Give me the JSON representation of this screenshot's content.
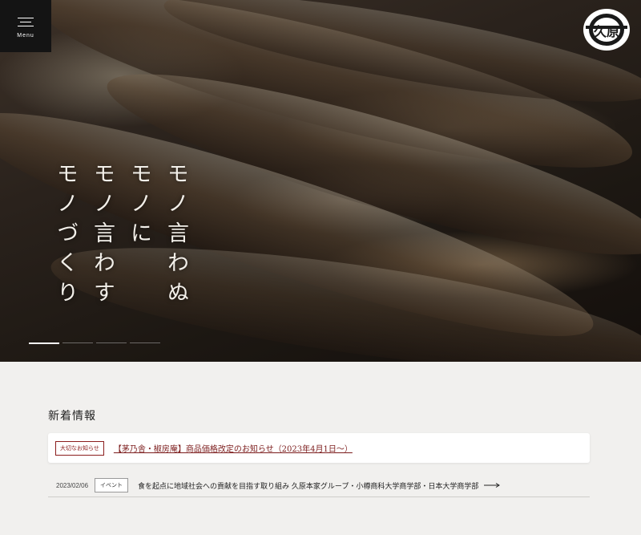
{
  "header": {
    "menu_label": "Menu",
    "logo_text": "久原"
  },
  "hero": {
    "tagline_columns": [
      "モノ言わぬ",
      "モノに",
      "モノ言わす",
      "モノづくり"
    ],
    "slides_total": 4,
    "active_slide": 1
  },
  "news": {
    "heading": "新着情報",
    "featured": {
      "badge": "大切なお知らせ",
      "title": "【茅乃舎・椒房庵】商品価格改定のお知らせ（2023年4月1日〜）"
    },
    "items": [
      {
        "date": "2023/02/06",
        "category": "イベント",
        "title": "食を起点に地域社会への貢献を目指す取り組み 久原本家グループ・小樽商科大学商学部・日本大学商学部 共…"
      }
    ]
  },
  "colors": {
    "accent": "#8b1d1d",
    "menu_bg": "#141414",
    "page_bg": "#f1f0ee"
  }
}
